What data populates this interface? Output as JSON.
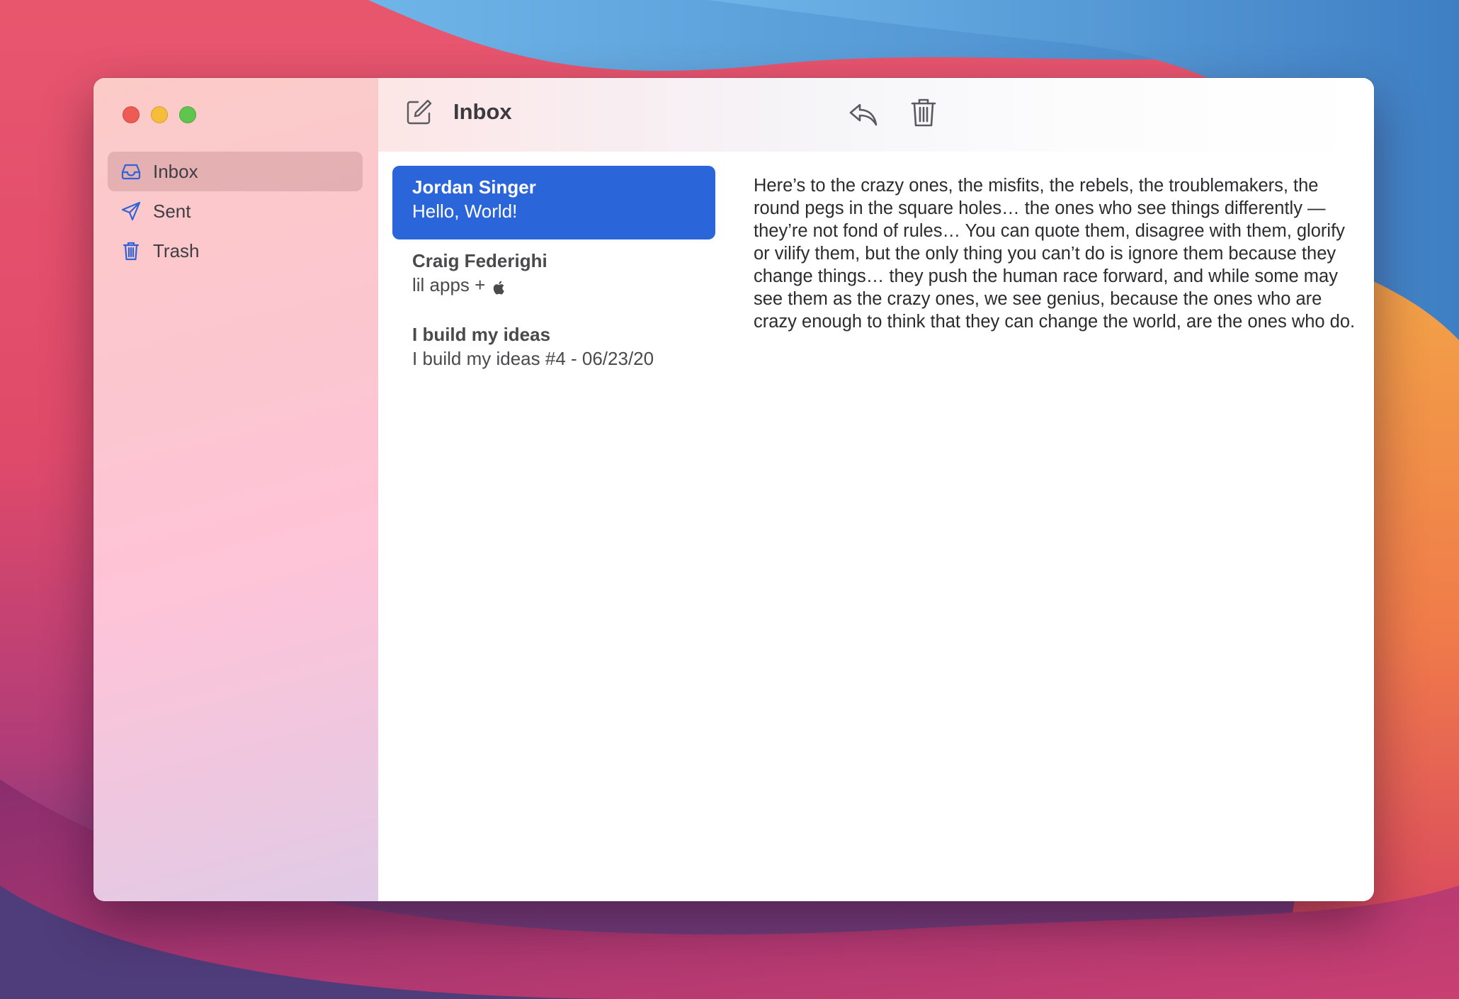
{
  "window": {
    "toolbar_title": "Inbox"
  },
  "sidebar": {
    "items": [
      {
        "label": "Inbox",
        "icon": "inbox-tray-icon",
        "active": true
      },
      {
        "label": "Sent",
        "icon": "paper-plane-icon",
        "active": false
      },
      {
        "label": "Trash",
        "icon": "trash-icon",
        "active": false
      }
    ]
  },
  "messages": [
    {
      "sender": "Jordan Singer",
      "subject": "Hello, World!",
      "selected": true
    },
    {
      "sender": "Craig Federighi",
      "subject": "lil apps +",
      "subject_icon": "apple-logo-icon",
      "selected": false
    },
    {
      "sender": "I build my ideas",
      "subject": "I build my ideas #4 - 06/23/20",
      "selected": false
    }
  ],
  "reader": {
    "body": "Here’s to the crazy ones, the misfits, the rebels, the troublemakers, the round pegs in the square holes… the ones who see things differently — they’re not fond of rules… You can quote them, disagree with them, glorify or vilify them, but the only thing you can’t do is ignore them because they change things… they push the human race forward, and while some may see them as the crazy ones, we see genius, because the ones who are crazy enough to think that they can change the world, are the ones who do."
  },
  "colors": {
    "accent": "#2a66d9",
    "icon_blue": "#2f63d6",
    "sidebar_active": "#e0aeb2"
  }
}
